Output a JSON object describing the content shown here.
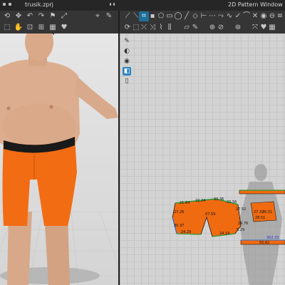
{
  "app": {
    "file_title": "trusik.zprj",
    "pattern_window_title": "2D Pattern Window"
  },
  "toolbar_3d": {
    "row1": [
      "rotate-icon",
      "move-icon",
      "undo-icon",
      "redo-icon",
      "flag-icon",
      "snap-icon",
      "pin-icon",
      "brush-icon"
    ],
    "row2": [
      "select-icon",
      "drag-icon",
      "lock-icon",
      "arrange-icon",
      "grid-icon",
      "heart-icon"
    ]
  },
  "toolbar_2d": {
    "row1": [
      "transform-pattern-icon",
      "edit-pattern-icon",
      "edit-curve-icon",
      "add-point-icon",
      "polygon-icon",
      "rectangle-icon",
      "circle-icon",
      "internal-line-icon",
      "dart-icon",
      "notch-icon",
      "seam-line-icon",
      "segment-seam-icon",
      "free-seam-icon",
      "check-seam-icon",
      "fold-icon",
      "tack-icon",
      "button-icon",
      "buttonhole-icon",
      "topstitch-icon",
      "zipper-icon"
    ],
    "row2": [
      "transform-icon",
      "edit-texture-icon",
      "sew-icon",
      "free-sew-icon",
      "elastic-icon",
      "pleat-icon",
      "fold-arrange-icon",
      "annotation-icon",
      "measure-icon",
      "ruler-icon",
      "graphic-icon",
      "trace-icon",
      "heart-icon",
      "grid-icon"
    ],
    "active_tool": "edit-curve-icon"
  },
  "side_tools": [
    {
      "name": "pen-icon",
      "active": false
    },
    {
      "name": "brush-icon",
      "active": false
    },
    {
      "name": "fill-icon",
      "active": false
    },
    {
      "name": "color-picker-icon",
      "active": true
    },
    {
      "name": "eraser-icon",
      "active": false
    }
  ],
  "pattern_labels": {
    "front": [
      "21.64",
      "22.24",
      "22.36",
      "23.56",
      "27.26",
      "27.52",
      "67.59",
      "30.37",
      "29.76",
      "24.29",
      "24.19",
      "5.29"
    ],
    "right": [
      "27.32",
      "26.51",
      "28.51",
      "302.33",
      "55.62"
    ]
  },
  "colors": {
    "pattern_fill": "#f06a10",
    "garment": "#f26c14",
    "waistband": "#1a1a1a",
    "seam_line": "#2a9a3a",
    "selection_blue": "#2b6fd6",
    "toolbar_bg": "#353535",
    "active_tool": "#1f6f9a"
  }
}
